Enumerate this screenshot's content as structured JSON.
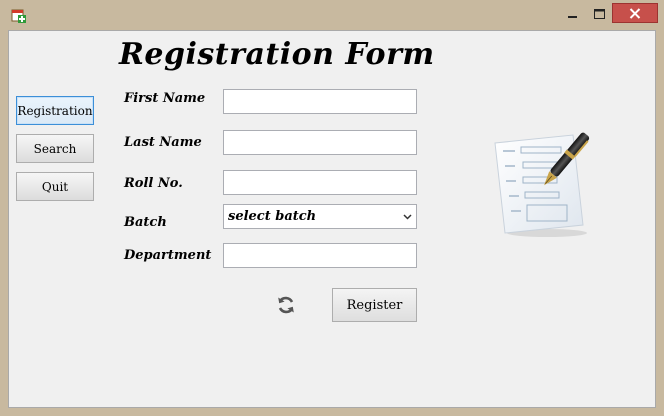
{
  "window": {
    "title": "",
    "controls": {
      "minimize_icon": "minimize-icon",
      "maximize_icon": "maximize-icon",
      "close_icon": "close-icon"
    },
    "close_color": "#c7504b"
  },
  "sidebar": {
    "items": [
      {
        "label": "Registration",
        "active": true
      },
      {
        "label": "Search",
        "active": false
      },
      {
        "label": "Quit",
        "active": false
      }
    ]
  },
  "form": {
    "title": "Registration Form",
    "fields": {
      "first_name": {
        "label": "First Name",
        "value": ""
      },
      "last_name": {
        "label": "Last Name",
        "value": ""
      },
      "roll_no": {
        "label": "Roll No.",
        "value": ""
      },
      "batch": {
        "label": "Batch",
        "selected": "select batch"
      },
      "department": {
        "label": "Department",
        "value": ""
      }
    },
    "reset_icon": "refresh-icon",
    "register_label": "Register"
  },
  "illustration_icon": "document-pen-icon",
  "colors": {
    "window_frame": "#c8b99f",
    "client_bg": "#f0f0f0",
    "active_border": "#3c8fd8"
  }
}
